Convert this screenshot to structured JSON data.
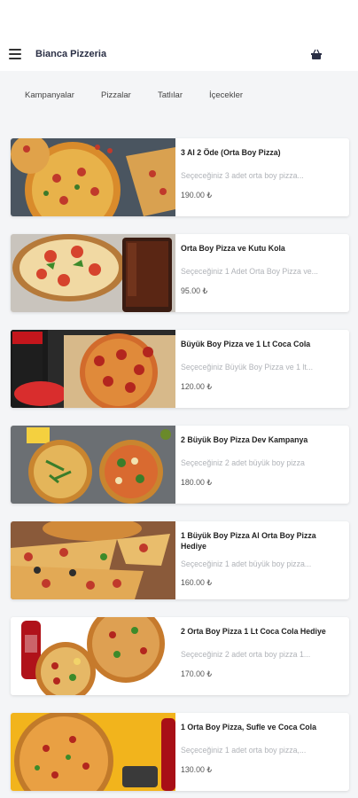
{
  "header": {
    "title": "Bianca Pizzeria",
    "menu_icon": "hamburger-menu-icon",
    "basket_icon": "basket-icon"
  },
  "tabs": [
    {
      "label": "Kampanyalar"
    },
    {
      "label": "Pizzalar"
    },
    {
      "label": "Tatlılar"
    },
    {
      "label": "İçecekler"
    }
  ],
  "products": [
    {
      "name": "3 Al 2 Öde (Orta Boy Pizza)",
      "description": "Seçeceğiniz 3 adet orta boy pizza...",
      "price": "190.00 ₺"
    },
    {
      "name": "Orta Boy Pizza ve Kutu Kola",
      "description": "Seçeceğiniz 1 Adet Orta Boy Pizza ve...",
      "price": "95.00 ₺"
    },
    {
      "name": "Büyük Boy Pizza ve 1 Lt Coca Cola",
      "description": "Seçeceğiniz Büyük Boy Pizza ve 1 lt...",
      "price": "120.00 ₺"
    },
    {
      "name": "2 Büyük Boy Pizza Dev Kampanya",
      "description": "Seçeceğiniz 2 adet büyük boy pizza",
      "price": "180.00 ₺"
    },
    {
      "name": "1 Büyük Boy Pizza Al Orta Boy Pizza Hediye",
      "description": "Seçeceğiniz 1 adet büyük boy pizza...",
      "price": "160.00 ₺"
    },
    {
      "name": "2 Orta Boy Pizza 1 Lt Coca Cola Hediye",
      "description": "Seçeceğiniz 2 adet orta boy pizza 1...",
      "price": "170.00 ₺"
    },
    {
      "name": "1 Orta Boy Pizza, Sufle ve Coca Cola",
      "description": "Seçeceğiniz 1 adet orta boy pizza,...",
      "price": "130.00 ₺"
    }
  ]
}
